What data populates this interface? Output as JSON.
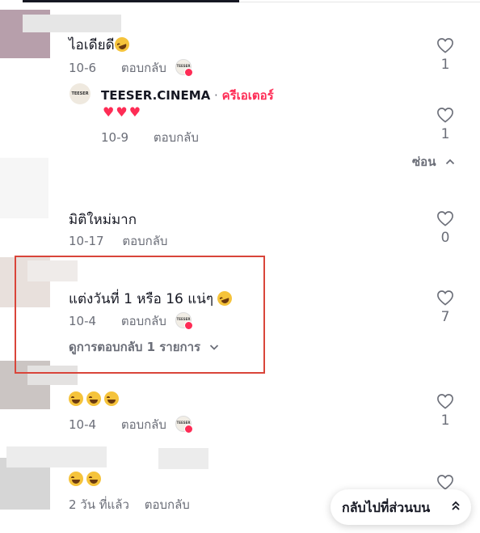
{
  "comments": [
    {
      "text": "ไอเดียดี",
      "date": "10-6",
      "reply_label": "ตอบกลับ",
      "likes": "1",
      "reply": {
        "author": "TEESER.CINEMA",
        "separator": "·",
        "role": "ครีเอเตอร์",
        "text": "♥♥♥",
        "date": "10-9",
        "reply_label": "ตอบกลับ",
        "likes": "1",
        "avatar_text": "TEESER"
      },
      "hide_label": "ซ่อน"
    },
    {
      "text": "มิติใหม่มาก",
      "date": "10-17",
      "reply_label": "ตอบกลับ",
      "likes": "0"
    },
    {
      "text": "แต่งวันที่ 1 หรือ 16 แน่ๆ",
      "date": "10-4",
      "reply_label": "ตอบกลับ",
      "likes": "7",
      "view_replies_label": "ดูการตอบกลับ 1 รายการ"
    },
    {
      "text": "",
      "date": "10-4",
      "reply_label": "ตอบกลับ",
      "likes": "1"
    },
    {
      "text": "",
      "date": "2 วัน ที่แล้ว",
      "reply_label": "ตอบกลับ",
      "likes": ""
    }
  ],
  "creator_badge_text": "TEESER",
  "back_to_top_label": "กลับไปที่ส่วนบน",
  "colors": {
    "accent": "#fe2c55",
    "text": "#161823",
    "muted": "#6b6e78",
    "highlight_box": "#d9453a"
  },
  "icons": [
    "heart-outline-icon",
    "chevron-up-icon",
    "chevron-down-icon",
    "double-chevron-up-icon",
    "laughing-emoji-icon"
  ]
}
